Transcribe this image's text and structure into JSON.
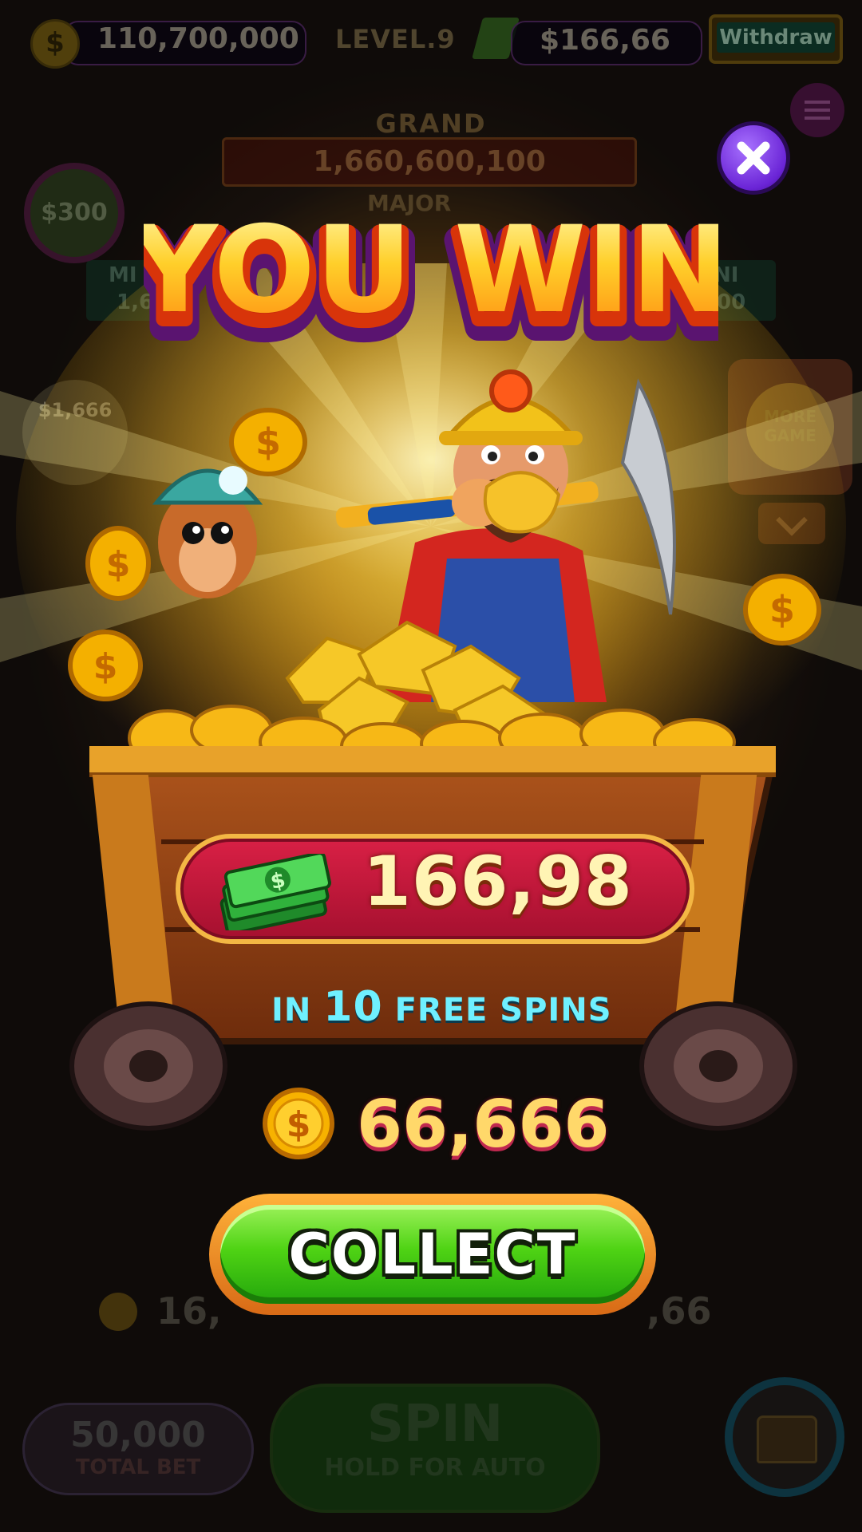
{
  "top_bar": {
    "coins": "110,700,000",
    "level_label": "LEVEL.9",
    "cash": "$166,66",
    "withdraw_label": "Withdraw"
  },
  "jackpots": {
    "grand_label": "GRAND",
    "grand_value": "1,660,600,100",
    "major_label": "MAJOR",
    "mini_left_label": "MI",
    "mini_left_value": "1,6",
    "mini_right_label": "NI",
    "mini_right_value": "00"
  },
  "side": {
    "bonus_300": "$300",
    "bonus_1666": "$1,666",
    "more_games": "MORE GAME"
  },
  "modal": {
    "title": "YOU WIN",
    "cash_amount": "166,98",
    "spins_prefix": "IN ",
    "spins_count": "10",
    "spins_suffix": " FREE SPINS",
    "coin_amount": "66,666",
    "collect_label": "COLLECT"
  },
  "bottom": {
    "win_left": "16,",
    "win_right": ",66",
    "total_bet_value": "50,000",
    "total_bet_label": "TOTAL BET",
    "spin_label": "SPIN",
    "spin_sub": "HOLD FOR AUTO"
  },
  "colors": {
    "accent_red": "#d92045",
    "accent_green": "#4fd314",
    "cash_text": "#fff4b4",
    "spins_text": "#6ff0ff",
    "coin_text": "#ffd86a"
  }
}
